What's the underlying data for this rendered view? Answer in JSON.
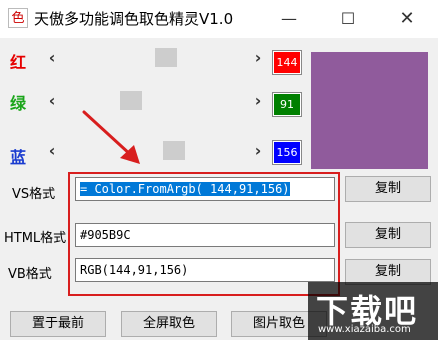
{
  "window": {
    "title": "天傲多功能调色取色精灵V1.0",
    "icon_char": "色",
    "minimize": "—",
    "maximize": "☐",
    "close": "✕"
  },
  "channels": {
    "red": {
      "label": "红",
      "value": "144",
      "color": "#ff0000",
      "text_color": "#ffffff",
      "label_color": "#e60000",
      "fraction": 0.565
    },
    "green": {
      "label": "绿",
      "value": "91",
      "color": "#008000",
      "text_color": "#ffffff",
      "label_color": "#1aa51a",
      "fraction": 0.357
    },
    "blue": {
      "label": "蓝",
      "value": "156",
      "color": "#0000ff",
      "text_color": "#ffffff",
      "label_color": "#1a3cd0",
      "fraction": 0.612
    },
    "left_arrow": "‹",
    "right_arrow": "›"
  },
  "swatch": {
    "color": "#905B9C"
  },
  "formats": {
    "vs": {
      "label": "VS格式",
      "value": " = Color.FromArgb( 144,91,156)",
      "copy": "复制"
    },
    "html": {
      "label": "HTML格式",
      "value": "#905B9C",
      "copy": "复制"
    },
    "vb": {
      "label": "VB格式",
      "value": "RGB(144,91,156)",
      "copy": "复制"
    }
  },
  "bottom_buttons": {
    "top_most": "置于最前",
    "full_screen_pick": "全屏取色",
    "image_pick": "图片取色"
  },
  "annotation": {
    "color": "#d81e1e"
  },
  "watermark": {
    "main": "下载吧",
    "sub": "www.xiazaiba.com"
  }
}
